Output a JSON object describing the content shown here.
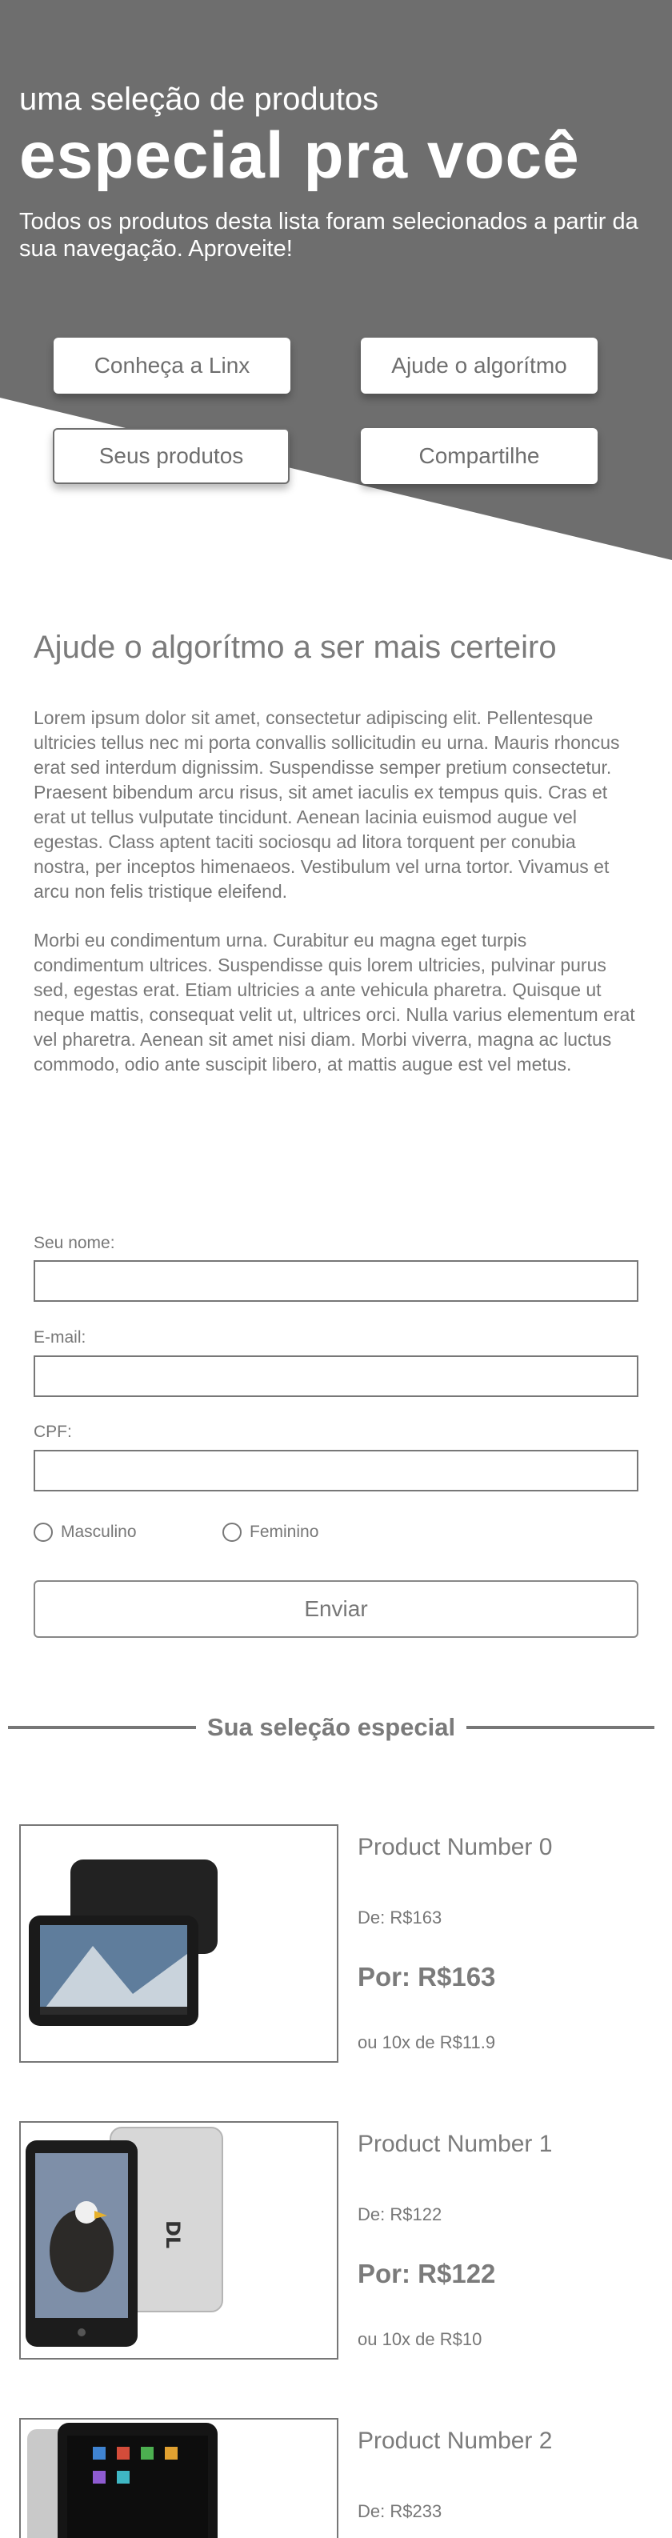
{
  "hero": {
    "subtitle": "uma seleção de produtos",
    "title": "especial pra você",
    "description": "Todos os produtos desta lista foram selecionados a partir da sua navegação. Aproveite!",
    "buttons": {
      "linx": "Conheça a Linx",
      "algorithm": "Ajude o algorítmo",
      "products": "Seus produtos",
      "share": "Compartilhe"
    }
  },
  "content": {
    "title": "Ajude o algorítmo a ser mais certeiro",
    "paragraph1": "Lorem ipsum dolor sit amet, consectetur adipiscing elit. Pellentesque ultricies tellus nec mi porta convallis sollicitudin eu urna. Mauris rhoncus erat sed interdum dignissim. Suspendisse semper pretium consectetur. Praesent bibendum arcu risus, sit amet iaculis ex tempus quis. Cras et erat ut tellus vulputate tincidunt. Aenean lacinia euismod augue vel egestas. Class aptent taciti sociosqu ad litora torquent per conubia nostra, per inceptos himenaeos. Vestibulum vel urna tortor. Vivamus et arcu non felis tristique eleifend.",
    "paragraph2": "Morbi eu condimentum urna. Curabitur eu magna eget turpis condimentum ultrices. Suspendisse quis lorem ultricies, pulvinar purus sed, egestas erat. Etiam ultricies a ante vehicula pharetra. Quisque ut neque mattis, consequat velit ut, ultrices orci. Nulla varius elementum erat vel pharetra. Aenean sit amet nisi diam. Morbi viverra, magna ac luctus commodo, odio ante suscipit libero, at mattis augue est vel metus."
  },
  "form": {
    "name_label": "Seu nome:",
    "name_value": "",
    "email_label": "E-mail:",
    "email_value": "",
    "cpf_label": "CPF:",
    "cpf_value": "",
    "gender_options": [
      "Masculino",
      "Feminino"
    ],
    "submit_label": "Enviar"
  },
  "selection": {
    "heading": "Sua seleção especial",
    "products": [
      {
        "name": "Product Number 0",
        "de": "De: R$163",
        "por": "Por: R$163",
        "installments": "ou 10x de R$11.9"
      },
      {
        "name": "Product Number 1",
        "de": "De: R$122",
        "por": "Por: R$122",
        "installments": "ou 10x de R$10"
      },
      {
        "name": "Product Number 2",
        "de": "De: R$233"
      }
    ]
  },
  "colors": {
    "hero_bg": "#6e6e6e",
    "text": "#777777",
    "border": "#777777"
  }
}
